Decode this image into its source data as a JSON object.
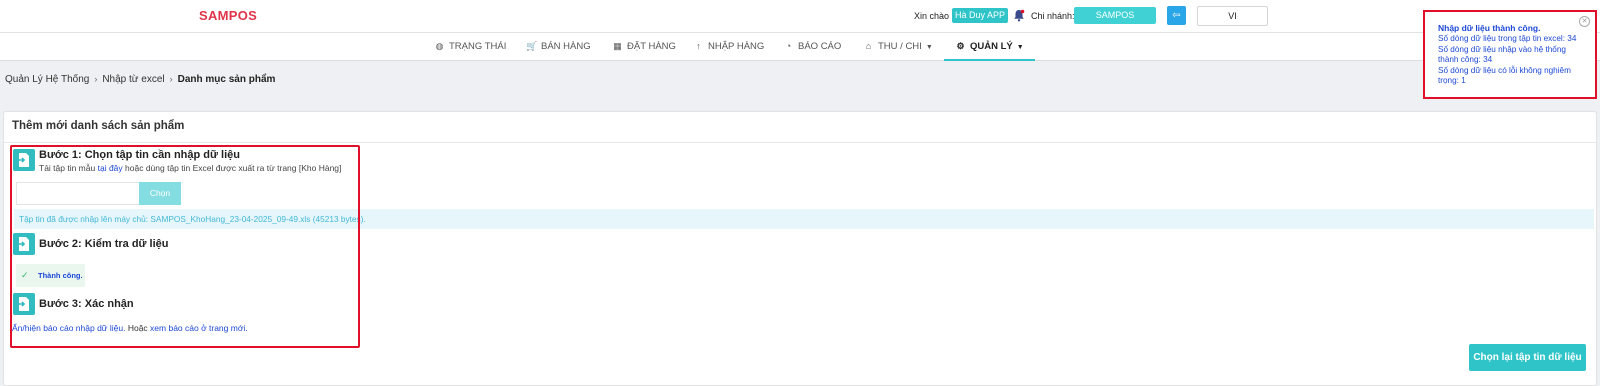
{
  "header": {
    "logo": "SAMPOS",
    "greeting": "Xin chào",
    "user_name": "Hà Duy APP",
    "branch_label": "Chi nhánh:",
    "branch_name": "SAMPOS",
    "language": "VI"
  },
  "nav": {
    "items": [
      {
        "label": "TRẠNG THÁI",
        "icon": "palette-icon"
      },
      {
        "label": "BÁN HÀNG",
        "icon": "cart-icon"
      },
      {
        "label": "ĐẶT HÀNG",
        "icon": "calendar-icon"
      },
      {
        "label": "NHẬP HÀNG",
        "icon": "arrow-up-icon"
      },
      {
        "label": "BÁO CÁO",
        "icon": "pie-chart-icon"
      },
      {
        "label": "THU / CHI",
        "icon": "bank-icon"
      },
      {
        "label": "QUẢN LÝ",
        "icon": "gear-icon"
      }
    ],
    "active": "QUẢN LÝ"
  },
  "breadcrumb": {
    "items": [
      "Quản Lý Hệ Thống",
      "Nhập từ excel"
    ],
    "current": "Danh mục sản phẩm"
  },
  "card": {
    "title": "Thêm mới danh sách sản phẩm",
    "step1": {
      "title": "Bước 1: Chọn tập tin cần nhập dữ liệu",
      "desc_prefix": "Tải tập tin mẫu",
      "desc_link": "tại đây",
      "desc_suffix": "hoặc dùng tập tin Excel được xuất ra từ trang [Kho Hàng]",
      "choose_button": "Chọn"
    },
    "upload_info": "Tập tin đã được nhập lên máy chủ: SAMPOS_KhoHang_23-04-2025_09-49.xls (45213 bytes).",
    "step2": {
      "title": "Bước 2: Kiểm tra dữ liệu",
      "status": "Thành công."
    },
    "step3": {
      "title": "Bước 3: Xác nhận",
      "report_link": "Ẩn/hiện báo cáo nhập dữ liệu.",
      "report_middle": "Hoặc",
      "report_newpage_link": "xem báo cáo ở trang mới."
    },
    "reselect_button": "Chọn lại tập tin dữ liệu"
  },
  "toast": {
    "title": "Nhập dữ liệu thành công.",
    "lines": [
      "Số dòng dữ liệu trong tập tin excel: 34",
      "Số dòng dữ liệu nhập vào hệ thống thành công: 34",
      "Số dòng dữ liệu có lỗi không nghiêm trọng: 1"
    ]
  },
  "colors": {
    "brand": "#e0344b",
    "accent": "#2fc4c8",
    "highlight": "#e0102a",
    "link": "#1d48d6"
  }
}
